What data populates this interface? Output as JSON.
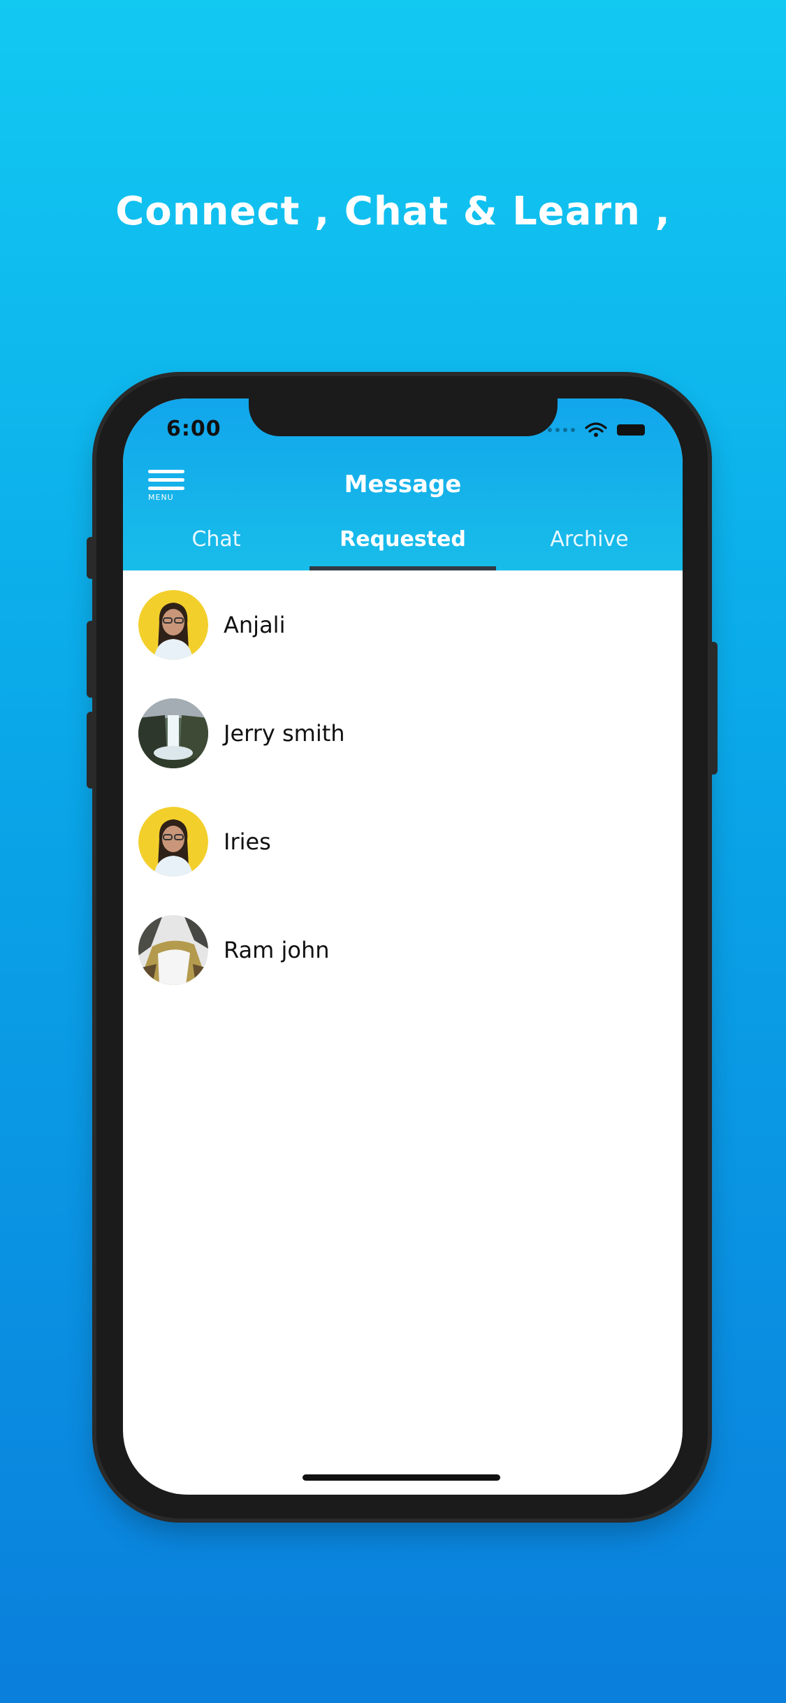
{
  "headline": "Connect , Chat & Learn ,",
  "status_bar": {
    "time": "6:00"
  },
  "header": {
    "menu_label": "MENU",
    "title": "Message"
  },
  "tabs": [
    {
      "label": "Chat"
    },
    {
      "label": "Requested"
    },
    {
      "label": "Archive"
    }
  ],
  "active_tab": "Requested",
  "contacts": [
    {
      "name": "Anjali",
      "avatar": "portrait-woman-yellow"
    },
    {
      "name": "Jerry smith",
      "avatar": "waterfall-landscape"
    },
    {
      "name": "Iries",
      "avatar": "portrait-woman-yellow"
    },
    {
      "name": "Ram john",
      "avatar": "waterfall-rocks"
    }
  ],
  "colors": {
    "accent": "#12a6ec",
    "header_gradient_top": "#12a6ec",
    "header_gradient_bottom": "#18bde9",
    "tab_indicator": "#2f3c46",
    "background_top": "#12c9f2",
    "background_bottom": "#0a7fdc"
  }
}
